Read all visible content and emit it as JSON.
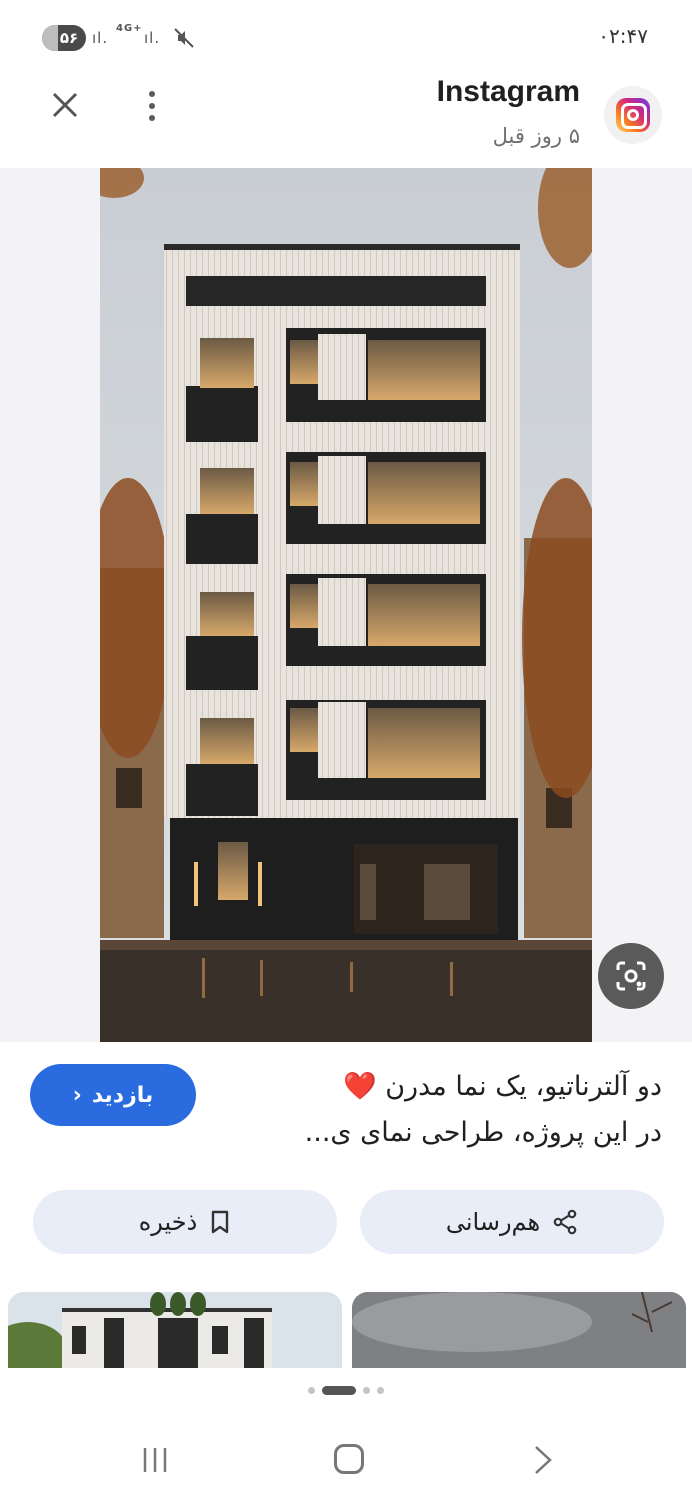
{
  "status_bar": {
    "clock": "۰۲:۴۷",
    "battery": "۵۶",
    "network": "4G+",
    "signal_icon": "signal-bars-icon",
    "mute_icon": "mute-icon"
  },
  "header": {
    "source_name": "Instagram",
    "time_ago": "۵ روز قبل",
    "close_icon": "close-icon",
    "more_icon": "more-vertical-icon",
    "source_icon": "instagram-icon"
  },
  "image": {
    "description_icon": "building-photo",
    "lens_icon": "google-lens-icon"
  },
  "caption": {
    "line1": "دو آلترناتیو، یک نما مدرن ❤️",
    "line2": "در این پروژه، طراحی نمای ی..."
  },
  "visit_button": {
    "label": "بازدید",
    "chevron": "‹"
  },
  "actions": {
    "share_label": "هم‌رسانی",
    "save_label": "ذخیره"
  },
  "pagination": {
    "count": 5,
    "active_index": 2
  },
  "colors": {
    "accent": "#2a6be0",
    "action_bg": "#e8edf8",
    "lens_bg": "#5a5a5a"
  }
}
